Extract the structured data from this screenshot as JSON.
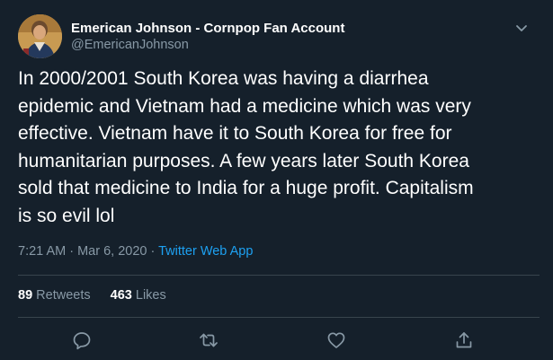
{
  "tweet": {
    "author": {
      "display_name": "Emerican Johnson - Cornpop Fan Account",
      "handle": "@EmericanJohnson"
    },
    "text_lines": [
      "In 2000/2001 South Korea was having a diarrhea",
      "epidemic and Vietnam had a medicine which was very",
      "effective. Vietnam have it to South Korea for free for",
      "humanitarian purposes. A few years later South Korea",
      "sold that medicine to India for a huge profit. Capitalism",
      "is so evil lol"
    ],
    "timestamp": "7:21 AM · Mar 6, 2020 · ",
    "source": "Twitter Web App",
    "retweets_count": "89",
    "retweets_label": "Retweets",
    "likes_count": "463",
    "likes_label": "Likes"
  },
  "icons": {
    "menu": "chevron-down-icon",
    "reply": "reply-icon",
    "retweet": "retweet-icon",
    "like": "heart-icon",
    "share": "share-icon"
  },
  "colors": {
    "background": "#15202b",
    "secondary_text": "#8899a6",
    "link": "#1da1f2",
    "divider": "#38444d"
  }
}
